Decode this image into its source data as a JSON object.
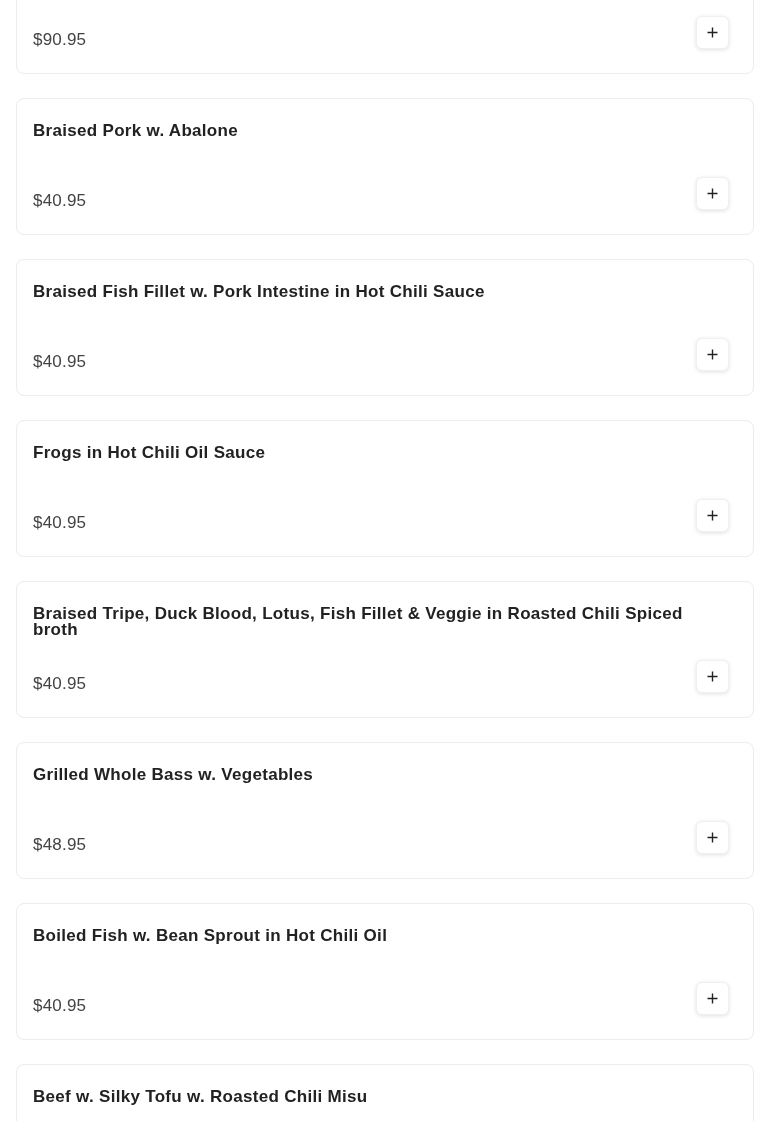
{
  "menu_items": [
    {
      "price": "$90.95"
    },
    {
      "name": "Braised Pork w. Abalone",
      "price": "$40.95"
    },
    {
      "name": "Braised Fish Fillet w. Pork Intestine in Hot Chili Sauce",
      "price": "$40.95"
    },
    {
      "name": "Frogs in Hot Chili Oil Sauce",
      "price": "$40.95"
    },
    {
      "name": "Braised Tripe, Duck Blood, Lotus, Fish Fillet & Veggie in Roasted Chili Spiced broth",
      "price": "$40.95"
    },
    {
      "name": "Grilled Whole Bass w. Vegetables",
      "price": "$48.95"
    },
    {
      "name": "Boiled Fish w. Bean Sprout in Hot Chili Oil",
      "price": "$40.95"
    },
    {
      "name": "Beef w. Silky Tofu w. Roasted Chili Misu"
    }
  ]
}
